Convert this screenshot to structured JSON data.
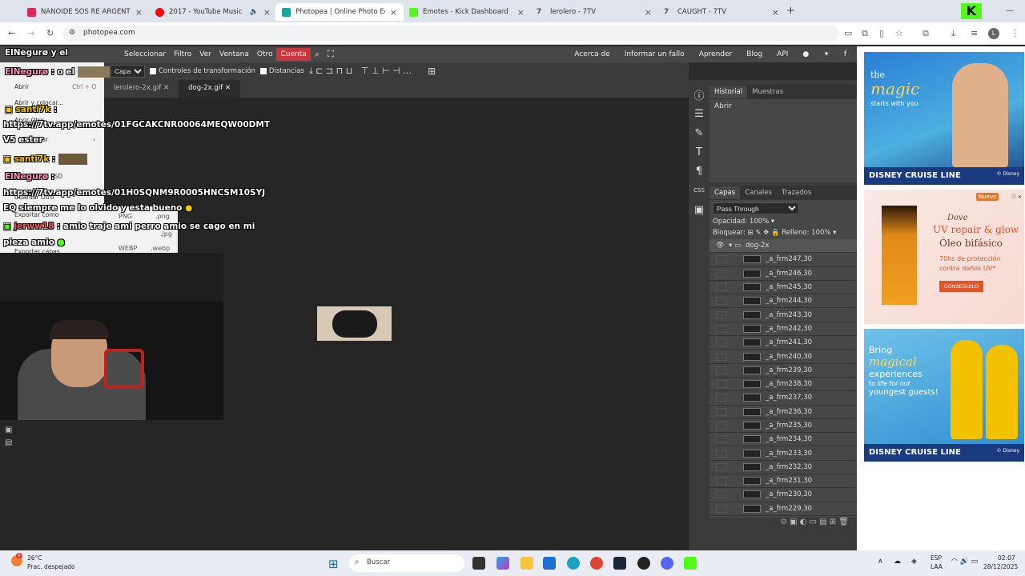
{
  "browser": {
    "tabs": [
      {
        "title": "NANOIDE SOS RE ARGENTINO",
        "color": "#e0245e",
        "active": false
      },
      {
        "title": "2017 - YouTube Music",
        "color": "#ff0000",
        "active": false
      },
      {
        "title": "Photopea | Online Photo Editor",
        "color": "#18a497",
        "active": true
      },
      {
        "title": "Emotes - Kick Dashboard",
        "color": "#53fc18",
        "active": false
      },
      {
        "title": "lerolero - 7TV",
        "color": "#555555",
        "active": false
      },
      {
        "title": "CAUGHT - 7TV",
        "color": "#555555",
        "active": false
      }
    ],
    "url": "photopea.com"
  },
  "photopea": {
    "menu": [
      "Seleccionar",
      "Filtro",
      "Ver",
      "Ventana",
      "Otro"
    ],
    "account": "Cuenta",
    "right_menu": [
      "Acerca de",
      "Informar un fallo",
      "Aprender",
      "Blog",
      "API"
    ],
    "options": {
      "select": "Capa",
      "transform_controls": "Controles de transformación",
      "distances": "Distancias"
    },
    "doc_tabs": [
      "lerolero-2x.gif",
      "dog-2x.gif"
    ],
    "history_tabs": [
      "Historial",
      "Muestras"
    ],
    "history_items": [
      "Abrir"
    ],
    "layer_tabs": [
      "Capas",
      "Canales",
      "Trazados"
    ],
    "blend_mode": "Pass Through",
    "opacity_label": "Opacidad:",
    "opacity_value": "100%",
    "lock_label": "Bloquear:",
    "fill_label": "Relleno:",
    "fill_value": "100%",
    "group_name": "dog-2x",
    "layers": [
      "_a_frm247,30",
      "_a_frm246,30",
      "_a_frm245,30",
      "_a_frm244,30",
      "_a_frm243,30",
      "_a_frm242,30",
      "_a_frm241,30",
      "_a_frm240,30",
      "_a_frm239,30",
      "_a_frm238,30",
      "_a_frm237,30",
      "_a_frm236,30",
      "_a_frm235,30",
      "_a_frm234,30",
      "_a_frm233,30",
      "_a_frm232,30",
      "_a_frm231,30",
      "_a_frm230,30",
      "_a_frm229,30"
    ]
  },
  "file_menu": {
    "items": [
      "Abrir",
      "Abrir y colocar...",
      "Abrir Otro",
      "Exportar",
      "como PSD",
      "Guardar Otro",
      "Exportar como",
      "Exportar capas"
    ],
    "shortcut": "Ctrl + O",
    "submenu": [
      {
        "name": "PNG",
        "ext": ".png"
      },
      {
        "name": "WEBP",
        "ext": ".webp"
      },
      {
        "name": "",
        "ext": ".jpg"
      }
    ]
  },
  "chat": {
    "lines": [
      {
        "user": "ElNegurø",
        "text": "y el"
      },
      {
        "user": "ElNegurø",
        "text": ": o el"
      },
      {
        "user": "santi7k",
        "text": ":"
      },
      {
        "user": "",
        "text": "https://7tv.app/emotes/01FGCAKCNR00064MEQW00DMT"
      },
      {
        "user": "",
        "text": "V5 ester"
      },
      {
        "user": "santi7k",
        "text": ":"
      },
      {
        "user": "ElNegurø",
        "text": ":"
      },
      {
        "user": "",
        "text": "https://7tv.app/emotes/01H0SQNM9R0005HNCSM10SYJ"
      },
      {
        "user": "",
        "text": "EQ siempre me lo olvido y esta bueno"
      },
      {
        "user": "jerww18",
        "text": ": amio traje ami perro amio se cago en mi"
      },
      {
        "user": "",
        "text": "pieza amio"
      }
    ]
  },
  "ads": {
    "ad1": {
      "line1": "the",
      "line2": "magic",
      "line3": "starts with you",
      "brand": "DISNEY CRUISE LINE",
      "copy": "© Disney"
    },
    "ad2": {
      "badge": "Nuevo",
      "brand": "Dove",
      "title": "UV repair & glow",
      "subtitle": "Óleo bifásico",
      "detail1": "70hs de protección",
      "detail2": "contra daños UV*",
      "cta": "CONSEGUILO"
    },
    "ad3": {
      "line1": "Bring",
      "line2": "magical",
      "line3": "experiences",
      "line4": "to life for our",
      "line5": "youngest guests!",
      "brand": "DISNEY CRUISE LINE",
      "copy": "© Disney"
    }
  },
  "taskbar": {
    "weather_temp": "26°C",
    "weather_desc": "Prac. despejado",
    "search": "Buscar",
    "lang1": "ESP",
    "lang2": "LAA",
    "time": "02:07",
    "date": "28/12/2025",
    "badge": "6"
  }
}
